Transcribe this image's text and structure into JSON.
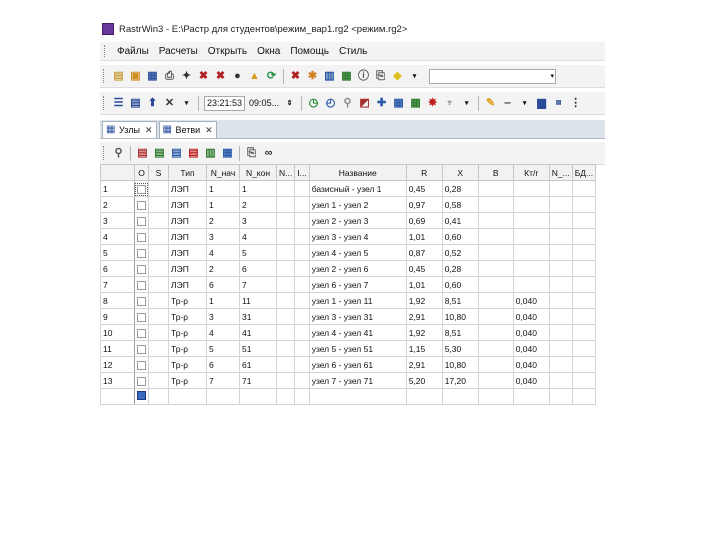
{
  "window": {
    "title": "RastrWin3 - E:\\Растр для студентов\\режим_вар1.rg2 <режим.rg2>"
  },
  "menu": {
    "items": [
      "Файлы",
      "Расчеты",
      "Открыть",
      "Окна",
      "Помощь",
      "Стиль"
    ]
  },
  "toolbar2": {
    "time1": "23:21:53",
    "time2": "09:05..."
  },
  "tabs": [
    {
      "label": "Узлы"
    },
    {
      "label": "Ветви"
    }
  ],
  "table": {
    "headers": [
      "",
      "О",
      "S",
      "Тип",
      "N_нач",
      "N_кон",
      "N...",
      "I...",
      "Название",
      "R",
      "X",
      "B",
      "Кт/r",
      "N_...",
      "БД..."
    ],
    "rows": [
      [
        "1",
        "ЛЭП",
        "1",
        "1",
        "базисный - узел 1",
        "0,45",
        "0,28",
        ""
      ],
      [
        "2",
        "ЛЭП",
        "1",
        "2",
        "узел 1 - узел 2",
        "0,97",
        "0,58",
        ""
      ],
      [
        "3",
        "ЛЭП",
        "2",
        "3",
        "узел 2 - узел 3",
        "0,69",
        "0,41",
        ""
      ],
      [
        "4",
        "ЛЭП",
        "3",
        "4",
        "узел 3 - узел 4",
        "1,01",
        "0,60",
        ""
      ],
      [
        "5",
        "ЛЭП",
        "4",
        "5",
        "узел 4 - узел 5",
        "0,87",
        "0,52",
        ""
      ],
      [
        "6",
        "ЛЭП",
        "2",
        "6",
        "узел 2 - узел 6",
        "0,45",
        "0,28",
        ""
      ],
      [
        "7",
        "ЛЭП",
        "6",
        "7",
        "узел 6 - узел 7",
        "1,01",
        "0,60",
        ""
      ],
      [
        "8",
        "Тр-р",
        "1",
        "11",
        "узел 1 - узел 11",
        "1,92",
        "8,51",
        "0,040"
      ],
      [
        "9",
        "Тр-р",
        "3",
        "31",
        "узел 3 - узел 31",
        "2,91",
        "10,80",
        "0,040"
      ],
      [
        "10",
        "Тр-р",
        "4",
        "41",
        "узел 4 - узел 41",
        "1,92",
        "8,51",
        "0,040"
      ],
      [
        "11",
        "Тр-р",
        "5",
        "51",
        "узел 5 - узел 51",
        "1,15",
        "5,30",
        "0,040"
      ],
      [
        "12",
        "Тр-р",
        "6",
        "61",
        "узел 6 - узел 61",
        "2,91",
        "10,80",
        "0,040"
      ],
      [
        "13",
        "Тр-р",
        "7",
        "71",
        "узел 7 - узел 71",
        "5,20",
        "17,20",
        "0,040"
      ]
    ]
  },
  "colors": {
    "window_icon": "#6a3a9a",
    "tab_bar": "#dde3ea",
    "toolbar_bg": "#f3f3f3",
    "grid_line": "#d4d4d4"
  }
}
